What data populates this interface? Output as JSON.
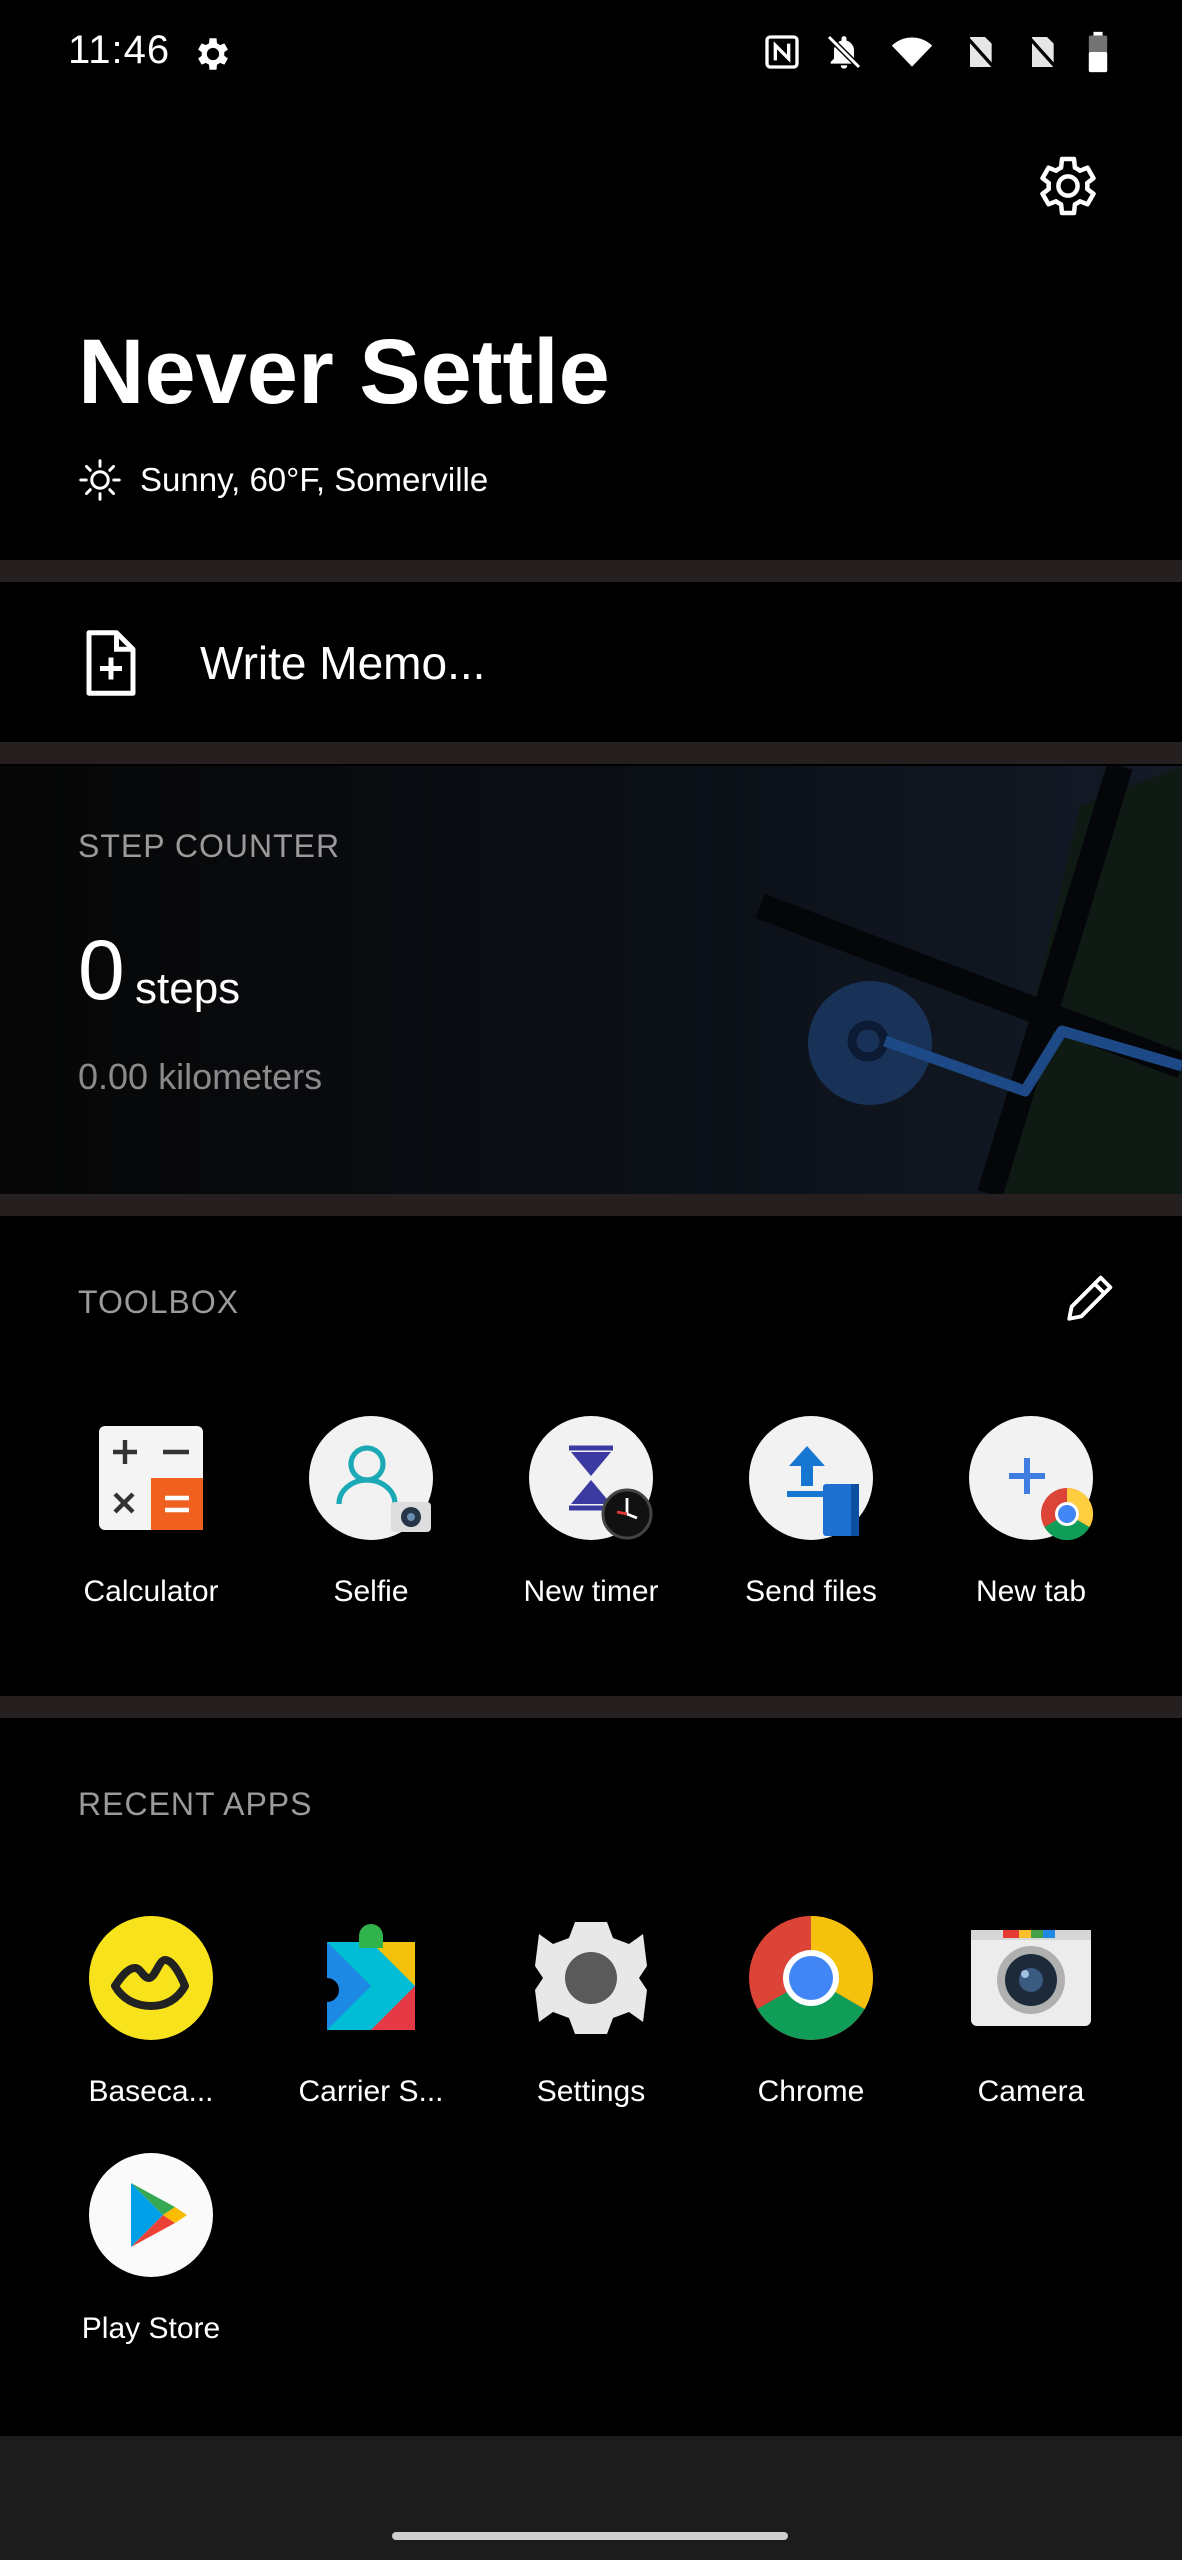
{
  "status_bar": {
    "time": "11:46",
    "icons": [
      "settings-icon",
      "nfc-icon",
      "notifications-off-icon",
      "wifi-icon",
      "no-sim-icon",
      "no-sim-icon",
      "battery-icon"
    ]
  },
  "header": {
    "title": "Never Settle",
    "weather": "Sunny, 60°F, Somerville",
    "weather_icon": "sun-icon",
    "settings_icon": "gear-icon"
  },
  "memo": {
    "label": "Write Memo...",
    "icon": "note-add-icon"
  },
  "step_counter": {
    "title": "STEP COUNTER",
    "steps": "0",
    "steps_unit": "steps",
    "distance": "0.00 kilometers"
  },
  "toolbox": {
    "title": "TOOLBOX",
    "edit_icon": "pencil-icon",
    "items": [
      {
        "label": "Calculator",
        "icon": "calculator-icon"
      },
      {
        "label": "Selfie",
        "icon": "selfie-icon"
      },
      {
        "label": "New timer",
        "icon": "timer-icon"
      },
      {
        "label": "Send files",
        "icon": "send-files-icon"
      },
      {
        "label": "New tab",
        "icon": "new-tab-icon"
      }
    ]
  },
  "recent_apps": {
    "title": "RECENT APPS",
    "items": [
      {
        "label": "Baseca...",
        "icon": "basecamp-icon"
      },
      {
        "label": "Carrier S...",
        "icon": "carrier-services-icon"
      },
      {
        "label": "Settings",
        "icon": "settings-gear-icon"
      },
      {
        "label": "Chrome",
        "icon": "chrome-icon"
      },
      {
        "label": "Camera",
        "icon": "camera-icon"
      },
      {
        "label": "Play Store",
        "icon": "play-store-icon"
      }
    ]
  },
  "colors": {
    "background": "#000000",
    "divider": "#251f1f",
    "muted_text": "#9a9a9a",
    "accent_blue": "#1e88e5"
  }
}
